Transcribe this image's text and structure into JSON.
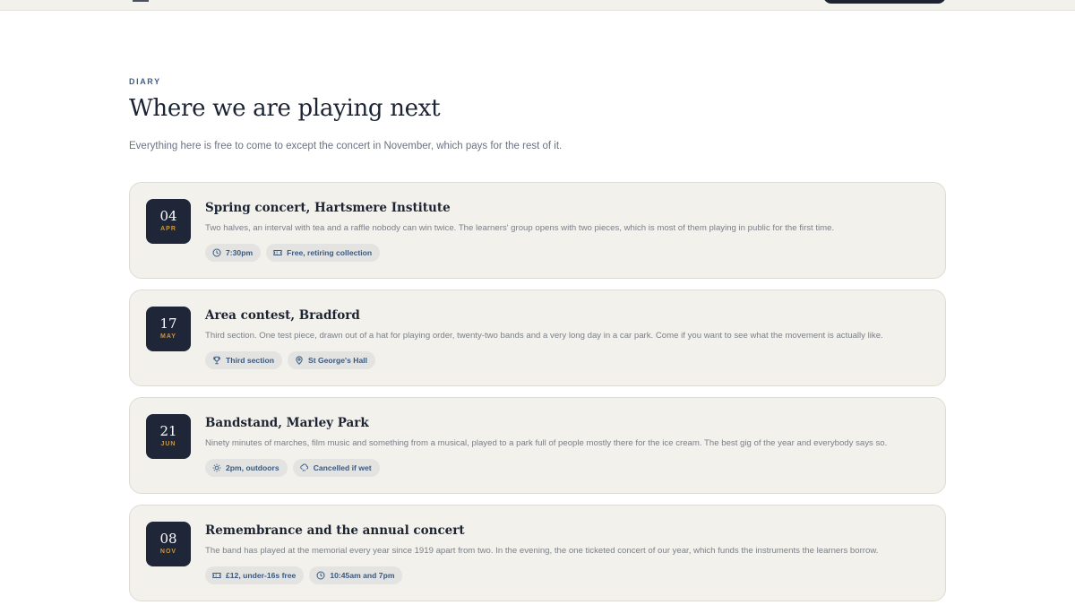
{
  "diary": {
    "eyebrow": "DIARY",
    "title": "Where we are playing next",
    "lede": "Everything here is free to come to except the concert in November, which pays for the rest of it."
  },
  "events": [
    {
      "day": "04",
      "month": "APR",
      "title": "Spring concert, Hartsmere Institute",
      "description": "Two halves, an interval with tea and a raffle nobody can win twice. The learners' group opens with two pieces, which is most of them playing in public for the first time.",
      "tags": [
        {
          "icon": "clock-icon",
          "label": "7:30pm"
        },
        {
          "icon": "ticket-icon",
          "label": "Free, retiring collection"
        }
      ]
    },
    {
      "day": "17",
      "month": "MAY",
      "title": "Area contest, Bradford",
      "description": "Third section. One test piece, drawn out of a hat for playing order, twenty-two bands and a very long day in a car park. Come if you want to see what the movement is actually like.",
      "tags": [
        {
          "icon": "trophy-icon",
          "label": "Third section"
        },
        {
          "icon": "map-pin-icon",
          "label": "St George's Hall"
        }
      ]
    },
    {
      "day": "21",
      "month": "JUN",
      "title": "Bandstand, Marley Park",
      "description": "Ninety minutes of marches, film music and something from a musical, played to a park full of people mostly there for the ice cream. The best gig of the year and everybody says so.",
      "tags": [
        {
          "icon": "sun-icon",
          "label": "2pm, outdoors"
        },
        {
          "icon": "rain-cloud-icon",
          "label": "Cancelled if wet"
        }
      ]
    },
    {
      "day": "08",
      "month": "NOV",
      "title": "Remembrance and the annual concert",
      "description": "The band has played at the memorial every year since 1919 apart from two. In the evening, the one ticketed concert of our year, which funds the instruments the learners borrow.",
      "tags": [
        {
          "icon": "ticket-icon",
          "label": "£12, under-16s free"
        },
        {
          "icon": "clock-icon",
          "label": "10:45am and 7pm"
        }
      ]
    }
  ]
}
